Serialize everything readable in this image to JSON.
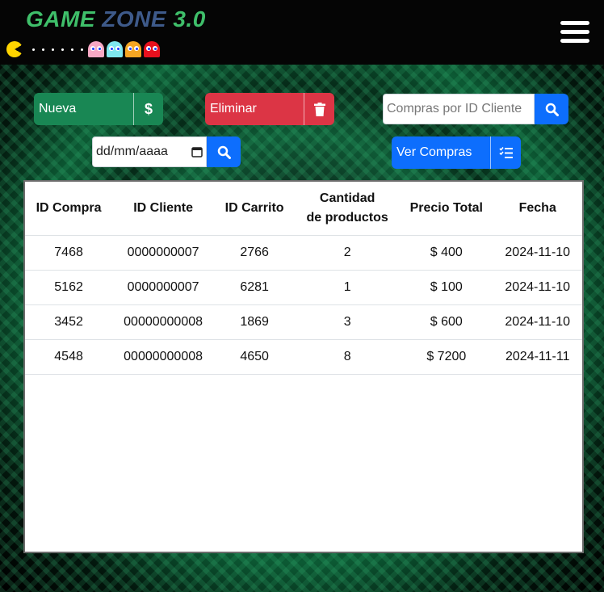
{
  "header": {
    "logo": {
      "word1": "GAME",
      "word2": "ZONE",
      "word3": "3.0"
    },
    "ghost_colors": [
      "#f7a8c4",
      "#7fe8f0",
      "#f5a623",
      "#e8101e"
    ],
    "pacman_color": "#ffd400",
    "menu_icon": "hamburger-icon"
  },
  "toolbar": {
    "new_label": "Nueva",
    "new_icon": "dollar-icon",
    "delete_label": "Eliminar",
    "delete_icon": "trash-icon",
    "search_placeholder": "Compras por ID Cliente",
    "search_icon": "search-icon",
    "date_placeholder": "dd/mm/aaaa",
    "view_label": "Ver Compras",
    "view_icon": "list-check-icon"
  },
  "colors": {
    "green": "#198754",
    "red": "#dc3545",
    "blue": "#0d6efd"
  },
  "table": {
    "headers": [
      "ID Compra",
      "ID Cliente",
      "ID Carrito",
      "Cantidad de productos",
      "Precio Total",
      "Fecha"
    ],
    "header_cantidad_line1": "Cantidad",
    "header_cantidad_line2": "de productos",
    "rows": [
      [
        "7468",
        "0000000007",
        "2766",
        "2",
        "$ 400",
        "2024-11-10"
      ],
      [
        "5162",
        "0000000007",
        "6281",
        "1",
        "$ 100",
        "2024-11-10"
      ],
      [
        "3452",
        "00000000008",
        "1869",
        "3",
        "$ 600",
        "2024-11-10"
      ],
      [
        "4548",
        "00000000008",
        "4650",
        "8",
        "$ 7200",
        "2024-11-11"
      ]
    ]
  }
}
